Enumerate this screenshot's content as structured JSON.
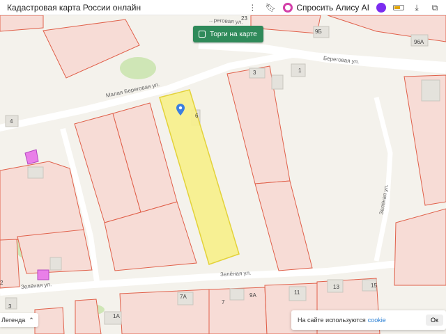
{
  "browser": {
    "title": "Кадастровая карта России онлайн",
    "alice_label": "Спросить Алису AI"
  },
  "map": {
    "torgi_button": "Торги на карте",
    "streets": {
      "malaya_beregovaya": "Малая Береговая ул.",
      "beregovaya_top": "Береговая ул.",
      "beregovaya_partial": "...реговая ул.",
      "zelenaya_bottom": "Зелёная ул.",
      "zelenaya_left": "Зелёная ул.",
      "zelenaya_right": "Зелёная ул."
    },
    "house_numbers": {
      "n9b": "9Б",
      "n96a": "96А",
      "n3": "3",
      "n1": "1",
      "n4": "4",
      "n6": "6",
      "n2": "2",
      "n3b": "3",
      "n11": "11",
      "n13": "13",
      "n15": "15",
      "n7a": "7А",
      "n9a": "9А",
      "n1a": "1А",
      "n23": "23",
      "n7": "7"
    },
    "colors": {
      "parcel_fill": "#f7dcd6",
      "parcel_stroke": "#e0604a",
      "selected_fill": "#f7f08a",
      "selected_stroke": "#e3d23a",
      "building": "#e97fe8",
      "marker": "#3b7fe0"
    }
  },
  "cookie_banner": {
    "text": "На сайте используются",
    "link": "cookie",
    "ok": "Ок"
  },
  "legend": {
    "label": "Легенда",
    "chevron": "chevron-up-icon"
  }
}
